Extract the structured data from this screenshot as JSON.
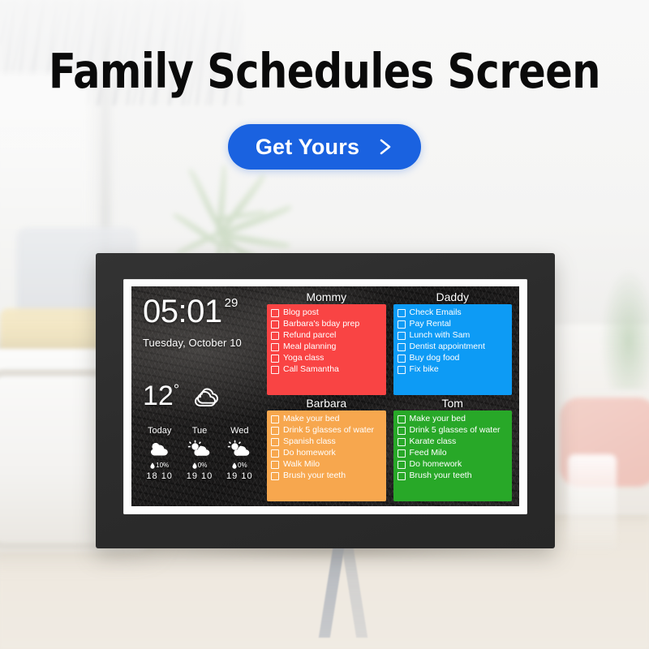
{
  "promo": {
    "headline": "Family Schedules Screen",
    "cta_label": "Get Yours",
    "cta_icon": "chevron-right-icon",
    "accent_blue": "#1a62e0"
  },
  "device": {
    "frame_color": "#2c2c2c",
    "bezel_color": "#fdfdfd"
  },
  "screen": {
    "clock": {
      "time": "05:01",
      "seconds": "29",
      "date": "Tuesday, October 10"
    },
    "weather": {
      "current_temp": "12",
      "current_degree": "°",
      "current_icon": "cloudy-icon",
      "forecast": [
        {
          "day": "Today",
          "icon": "cloudy-icon",
          "rain": "10%",
          "high": "18",
          "low": "10"
        },
        {
          "day": "Tue",
          "icon": "partly-sunny-icon",
          "rain": "0%",
          "high": "19",
          "low": "10"
        },
        {
          "day": "Wed",
          "icon": "partly-sunny-icon",
          "rain": "0%",
          "high": "19",
          "low": "10"
        }
      ]
    },
    "lists": [
      {
        "name": "Mommy",
        "color": "#f94444",
        "tasks": [
          "Blog post",
          "Barbara's bday prep",
          "Refund parcel",
          "Meal planning",
          "Yoga class",
          "Call Samantha"
        ]
      },
      {
        "name": "Daddy",
        "color": "#0d9bf5",
        "tasks": [
          "Check Emails",
          "Pay Rental",
          "Lunch with Sam",
          "Dentist appointment",
          "Buy dog food",
          "Fix bike"
        ]
      },
      {
        "name": "Barbara",
        "color": "#f7a74e",
        "tasks": [
          "Make your bed",
          "Drink 5 glasses of water",
          "Spanish class",
          "Do homework",
          "Walk Milo",
          "Brush your teeth"
        ]
      },
      {
        "name": "Tom",
        "color": "#28a828",
        "tasks": [
          "Make your bed",
          "Drink 5 glasses of water",
          "Karate class",
          "Feed Milo",
          "Do homework",
          "Brush your teeth"
        ]
      }
    ]
  }
}
